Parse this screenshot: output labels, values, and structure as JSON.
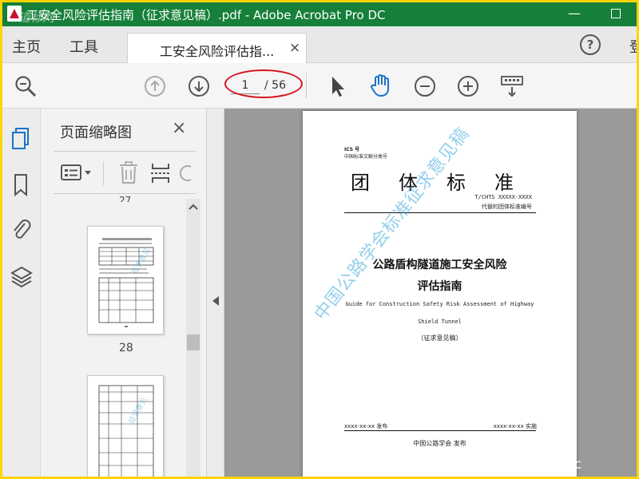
{
  "window": {
    "title": "工安全风险评估指南（征求意见稿）.pdf - Adobe Acrobat Pro DC",
    "watermark_top": "道标网",
    "min_label": "—"
  },
  "menu": {
    "home": "主页",
    "tools": "工具",
    "doc_tab": "工安全风险评估指...",
    "tab_close": "×",
    "help": "?",
    "login_cut": "登"
  },
  "toolbar": {
    "current_page": "1",
    "total_pages": "/ 56",
    "oval_color": "#d9121b"
  },
  "thumbnails_pane": {
    "title": "页面缩略图",
    "close": "×",
    "pages": [
      {
        "label": "27"
      },
      {
        "label": "28"
      },
      {
        "label": ""
      }
    ]
  },
  "document_page": {
    "ics": "ICS 号",
    "ccs": "中国标准文献分类号",
    "standard_type": "团体标准",
    "standard_code": "T/CHTS XXXXX-XXXX",
    "replaces": "代替的团体标准编号",
    "title_line1": "公路盾构隧道施工安全风险",
    "title_line2": "评估指南",
    "english_line1": "Guide for Construction Safety Risk Assessment of Highway",
    "english_line2": "Shield Tunnel",
    "draft": "（征求意见稿）",
    "issue_date": "xxxx-xx-xx 发布",
    "effective_date": "xxxx-xx-xx 实施",
    "publisher": "中国公路学会  发布",
    "watermark_diag": "中国公路学会标准征求意见稿"
  },
  "watermark_bottom": "www.cnc",
  "colors": {
    "titlebar": "#16803a",
    "frame": "#ffd400",
    "accent_blue": "#1a73c8",
    "oval": "#d9121b"
  }
}
